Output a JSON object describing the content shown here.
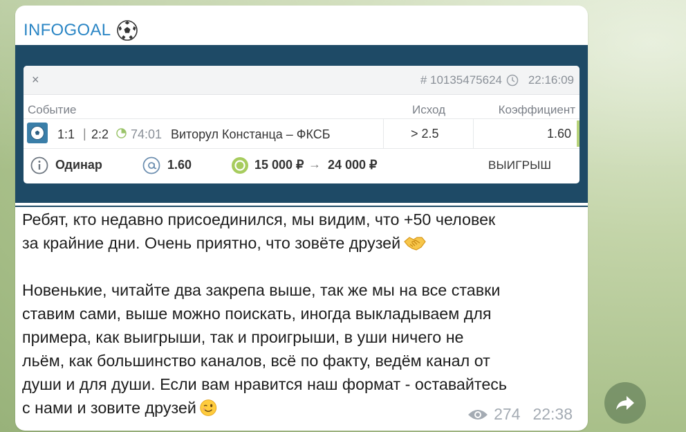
{
  "channel": {
    "name": "INFOGOAL",
    "emoji_icon": "soccer-ball-icon"
  },
  "bet_slip": {
    "ticket_id": "# 10135475624",
    "time": "22:16:09",
    "columns": {
      "event": "Событие",
      "outcome": "Исход",
      "coefficient": "Коэффициент"
    },
    "event_row": {
      "score_main": "1:1",
      "score_sep": "|",
      "score_second": "2:2",
      "minute": "74:01",
      "match": "Виторул Констанца – ФКСБ",
      "outcome": "> 2.5",
      "coefficient": "1.60"
    },
    "footer": {
      "bet_type": "Одинар",
      "total_coef": "1.60",
      "stake": "15 000 ₽",
      "arrow": "→",
      "payout": "24 000 ₽",
      "result": "ВЫИГРЫШ"
    },
    "close_symbol": "×"
  },
  "message": {
    "line1": "Ребят, кто недавно присоединился, мы видим, что +50 человек",
    "line2": "за крайние дни. Очень приятно, что зовёте друзей",
    "line3": "Новенькие, читайте два закрепа выше, так же мы на все ставки",
    "line4": "ставим сами, выше можно поискать, иногда выкладываем для",
    "line5": "примера, как выигрыши, так и проигрыши, в уши ничего не",
    "line6": "льём, как большинство каналов, всё по факту, ведём канал от",
    "line7": "души и для души. Если вам нравится наш формат - оставайтесь",
    "line8": "с нами и зовите друзей"
  },
  "meta": {
    "views": "274",
    "time": "22:38"
  },
  "colors": {
    "channel_name": "#2b86c5",
    "slip_frame": "#1e4a66",
    "win_bar": "#b7d37a"
  }
}
